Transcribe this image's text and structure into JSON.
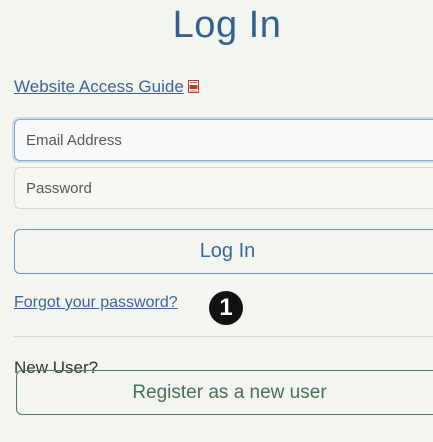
{
  "login": {
    "title": "Log In",
    "guide_link": "Website Access Guide",
    "guide_icon": "pdf-icon",
    "email_placeholder": "Email Address",
    "password_placeholder": "Password",
    "login_button": "Log In",
    "forgot_link": "Forgot your password?",
    "step_badge": "1",
    "new_user_label": "New User?",
    "register_button": "Register as a new user"
  },
  "colors": {
    "accent": "#365f8f",
    "link": "#3f6396",
    "register_accent": "#4f7a62",
    "background": "#f3f6ef"
  }
}
